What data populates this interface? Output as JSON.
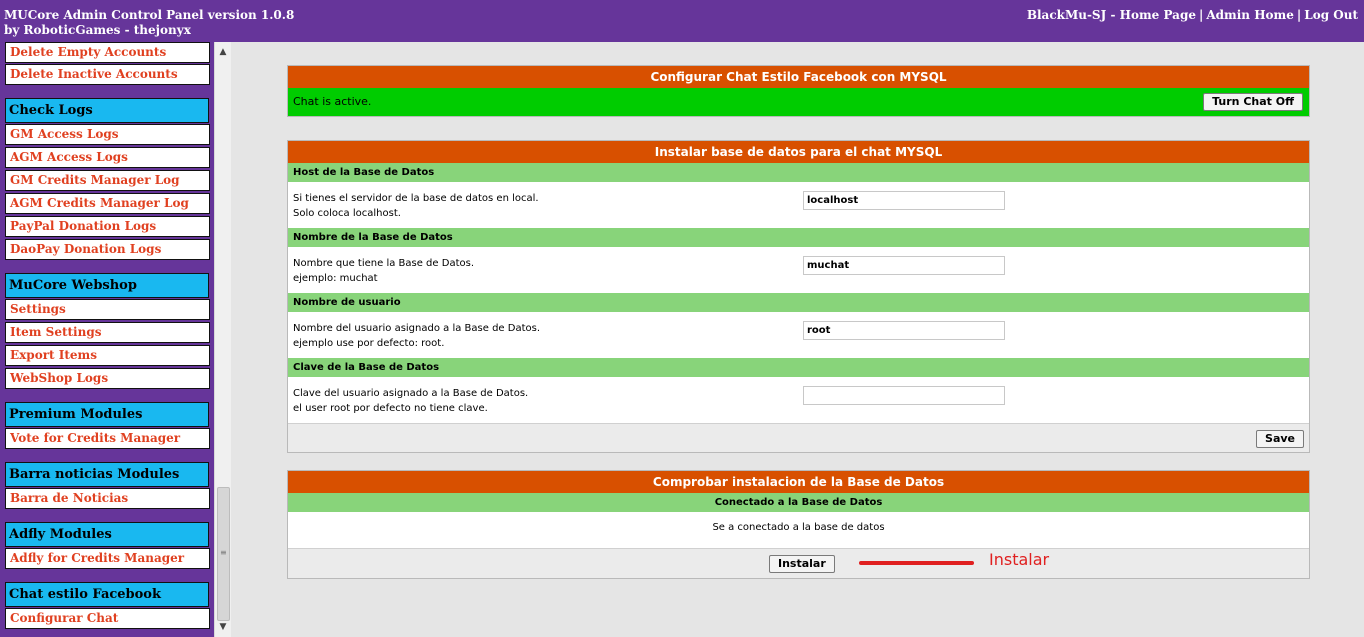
{
  "header": {
    "title_line1": "MUCore Admin Control Panel version 1.0.8",
    "title_line2": "by RoboticGames - thejonyx",
    "links": [
      "BlackMu-SJ - Home Page",
      "Admin Home",
      "Log Out"
    ],
    "separator": "|"
  },
  "sidebar": {
    "items_top": [
      "Delete Empty Accounts",
      "Delete Inactive Accounts"
    ],
    "groups": [
      {
        "title": "Check Logs",
        "items": [
          "GM Access Logs",
          "AGM Access Logs",
          "GM Credits Manager Log",
          "AGM Credits Manager Log",
          "PayPal Donation Logs",
          "DaoPay Donation Logs"
        ]
      },
      {
        "title": "MuCore Webshop",
        "items": [
          "Settings",
          "Item Settings",
          "Export Items",
          "WebShop Logs"
        ]
      },
      {
        "title": "Premium Modules",
        "items": [
          "Vote for Credits Manager"
        ]
      },
      {
        "title": "Barra noticias Modules",
        "items": [
          "Barra de Noticias"
        ]
      },
      {
        "title": "Adfly Modules",
        "items": [
          "Adfly for Credits Manager"
        ]
      },
      {
        "title": "Chat estilo Facebook",
        "items": [
          "Configurar Chat"
        ]
      }
    ]
  },
  "chat_panel": {
    "title": "Configurar Chat Estilo Facebook con MYSQL",
    "status": "Chat is active.",
    "toggle_button": "Turn Chat Off",
    "status_color": "#00cc00"
  },
  "db_panel": {
    "title": "Instalar base de datos para el chat MYSQL",
    "sections": [
      {
        "head": "Host de la Base de Datos",
        "desc1": "Si tienes el servidor de la base de datos en local.",
        "desc2": "Solo coloca localhost.",
        "value": "localhost"
      },
      {
        "head": "Nombre de la Base de Datos",
        "desc1": "Nombre que tiene la Base de Datos.",
        "desc2": "ejemplo: muchat",
        "value": "muchat"
      },
      {
        "head": "Nombre de usuario",
        "desc1": "Nombre del usuario asignado a la Base de Datos.",
        "desc2": "ejemplo use por defecto: root.",
        "value": "root"
      },
      {
        "head": "Clave de la Base de Datos",
        "desc1": "Clave del usuario asignado a la Base de Datos.",
        "desc2": "el user root por defecto no tiene clave.",
        "value": ""
      }
    ],
    "save_button": "Save"
  },
  "check_panel": {
    "title": "Comprobar instalacion de la Base de Datos",
    "subhead": "Conectado a la Base de Datos",
    "message": "Se a conectado a la base de datos",
    "install_button": "Instalar"
  },
  "annotation": {
    "text": "Instalar",
    "color": "#e02020"
  },
  "colors": {
    "header_purple": "#66359a",
    "panel_orange": "#d85000",
    "section_green": "#88d47a",
    "sidebar_head_blue": "#19b8f0",
    "link_red": "#e04020"
  }
}
